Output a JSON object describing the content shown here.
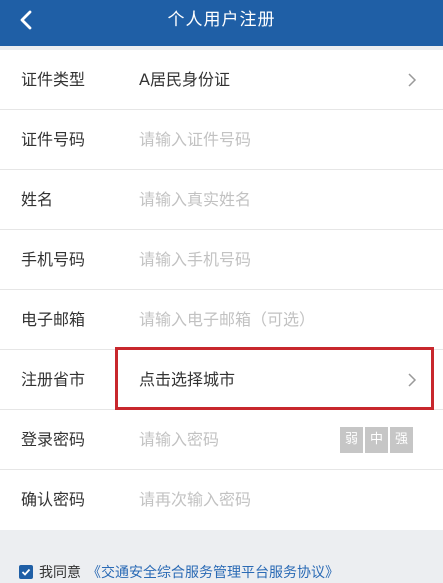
{
  "header": {
    "title": "个人用户注册"
  },
  "form": {
    "id_type": {
      "label": "证件类型",
      "value": "A居民身份证"
    },
    "id_number": {
      "label": "证件号码",
      "placeholder": "请输入证件号码"
    },
    "name": {
      "label": "姓名",
      "placeholder": "请输入真实姓名"
    },
    "phone": {
      "label": "手机号码",
      "placeholder": "请输入手机号码"
    },
    "email": {
      "label": "电子邮箱",
      "placeholder": "请输入电子邮箱（可选）"
    },
    "region": {
      "label": "注册省市",
      "value": "点击选择城市"
    },
    "password": {
      "label": "登录密码",
      "placeholder": "请输入密码",
      "strength": [
        "弱",
        "中",
        "强"
      ]
    },
    "confirm_password": {
      "label": "确认密码",
      "placeholder": "请再次输入密码"
    }
  },
  "agreement": {
    "checked": true,
    "text": "我同意",
    "link": "《交通安全综合服务管理平台服务协议》"
  },
  "colors": {
    "header_bg": "#1f5fa6",
    "highlight_border": "#c8272d",
    "link": "#2a6ab5",
    "strength_bg": "#c6c6c6"
  }
}
